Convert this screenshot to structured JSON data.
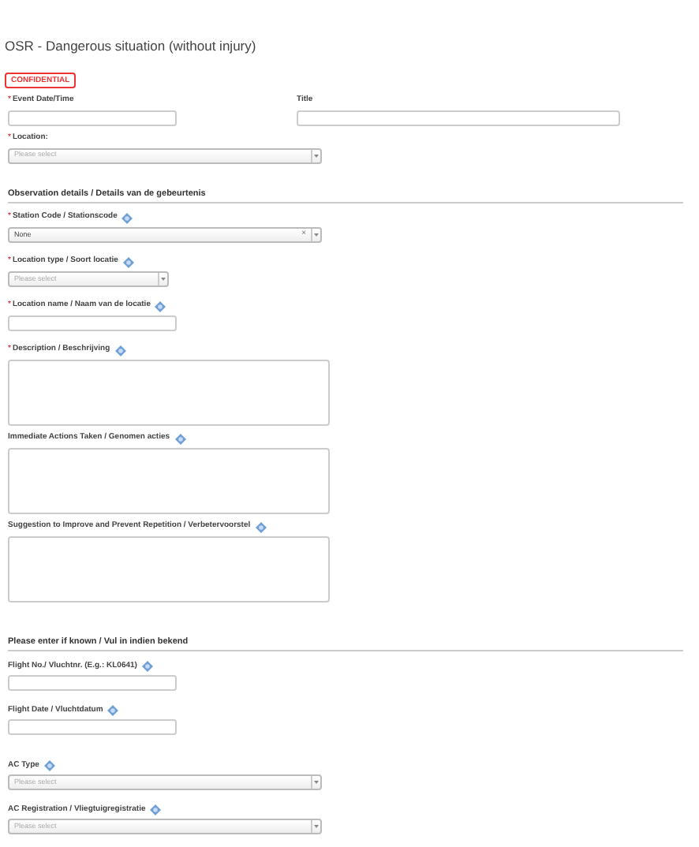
{
  "title": "OSR - Dangerous situation (without injury)",
  "badge": "CONFIDENTIAL",
  "top_row": [
    {
      "kind": "text",
      "label": "Event Date/Time",
      "required_mark": "*",
      "help": false
    },
    {
      "kind": "text",
      "label": "Title",
      "help": false
    }
  ],
  "rows": [
    {
      "kind": "select",
      "label": "Location:",
      "required_mark": "*",
      "help": false,
      "placeholder": "Please select"
    },
    {
      "kind": "heading",
      "label": "Observation details / Details van de gebeurtenis"
    },
    {
      "kind": "select",
      "label": "Station Code / Stationscode",
      "required_mark": "*",
      "help": true,
      "value": "None",
      "clear": "×"
    },
    {
      "kind": "short-select",
      "label": "Location type / Soort locatie",
      "required_mark": "*",
      "help": true,
      "placeholder": "Please select"
    },
    {
      "kind": "text",
      "label": "Location name / Naam van de locatie",
      "required_mark": "*",
      "help": true
    },
    {
      "kind": "textarea",
      "label": "Description / Beschrijving",
      "required_mark": "*",
      "help": true
    },
    {
      "kind": "textarea",
      "label": "Immediate Actions Taken / Genomen acties",
      "help": true
    },
    {
      "kind": "textarea",
      "label": "Suggestion to Improve and Prevent Repetition / Verbetervoorstel",
      "help": true
    },
    {
      "kind": "heading",
      "label": "Please enter if known / Vul in indien bekend"
    },
    {
      "kind": "text",
      "label": "Flight No./ Vluchtnr. (E.g.: KL0641)",
      "help": true
    },
    {
      "kind": "text",
      "label": "Flight Date / Vluchtdatum",
      "help": true
    },
    {
      "kind": "select",
      "label": "AC Type",
      "help": true,
      "placeholder": "Please select"
    },
    {
      "kind": "select",
      "label": "AC Registration / Vliegtuigregistratie",
      "help": true,
      "placeholder": "Please select"
    }
  ]
}
